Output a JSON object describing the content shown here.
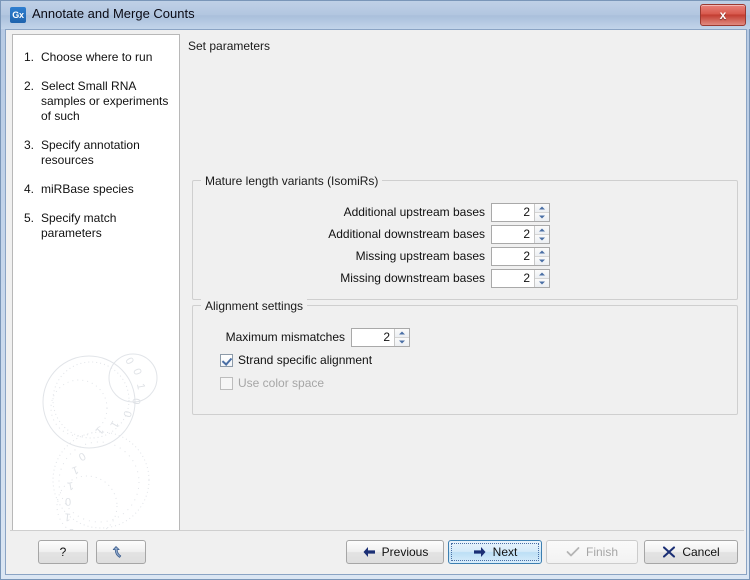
{
  "window": {
    "title": "Annotate and Merge Counts",
    "app_icon_text": "Gx",
    "close_label": "x",
    "accent_color": "#4a6fa5",
    "titlebar_color": "#b2c6e0",
    "close_color": "#c33d31"
  },
  "sidebar": {
    "steps": [
      {
        "number": "1.",
        "label": "Choose where to run"
      },
      {
        "number": "2.",
        "label": "Select Small RNA samples or experiments of such"
      },
      {
        "number": "3.",
        "label": "Specify annotation resources"
      },
      {
        "number": "4.",
        "label": "miRBase species"
      },
      {
        "number": "5.",
        "label": "Specify match parameters"
      }
    ]
  },
  "main": {
    "heading": "Set parameters",
    "isomirs_group": {
      "title": "Mature length variants (IsomiRs)",
      "fields": [
        {
          "label": "Additional upstream bases",
          "value": "2"
        },
        {
          "label": "Additional downstream bases",
          "value": "2"
        },
        {
          "label": "Missing upstream bases",
          "value": "2"
        },
        {
          "label": "Missing downstream bases",
          "value": "2"
        }
      ]
    },
    "alignment_group": {
      "title": "Alignment settings",
      "mismatch_label": "Maximum mismatches",
      "mismatch_value": "2",
      "checkboxes": [
        {
          "label": "Strand specific alignment",
          "checked": true,
          "disabled": false
        },
        {
          "label": "Use color space",
          "checked": false,
          "disabled": true
        }
      ]
    }
  },
  "bottombar": {
    "help_label": "?",
    "reset_label": "",
    "previous_label": "Previous",
    "next_label": "Next",
    "finish_label": "Finish",
    "cancel_label": "Cancel"
  }
}
